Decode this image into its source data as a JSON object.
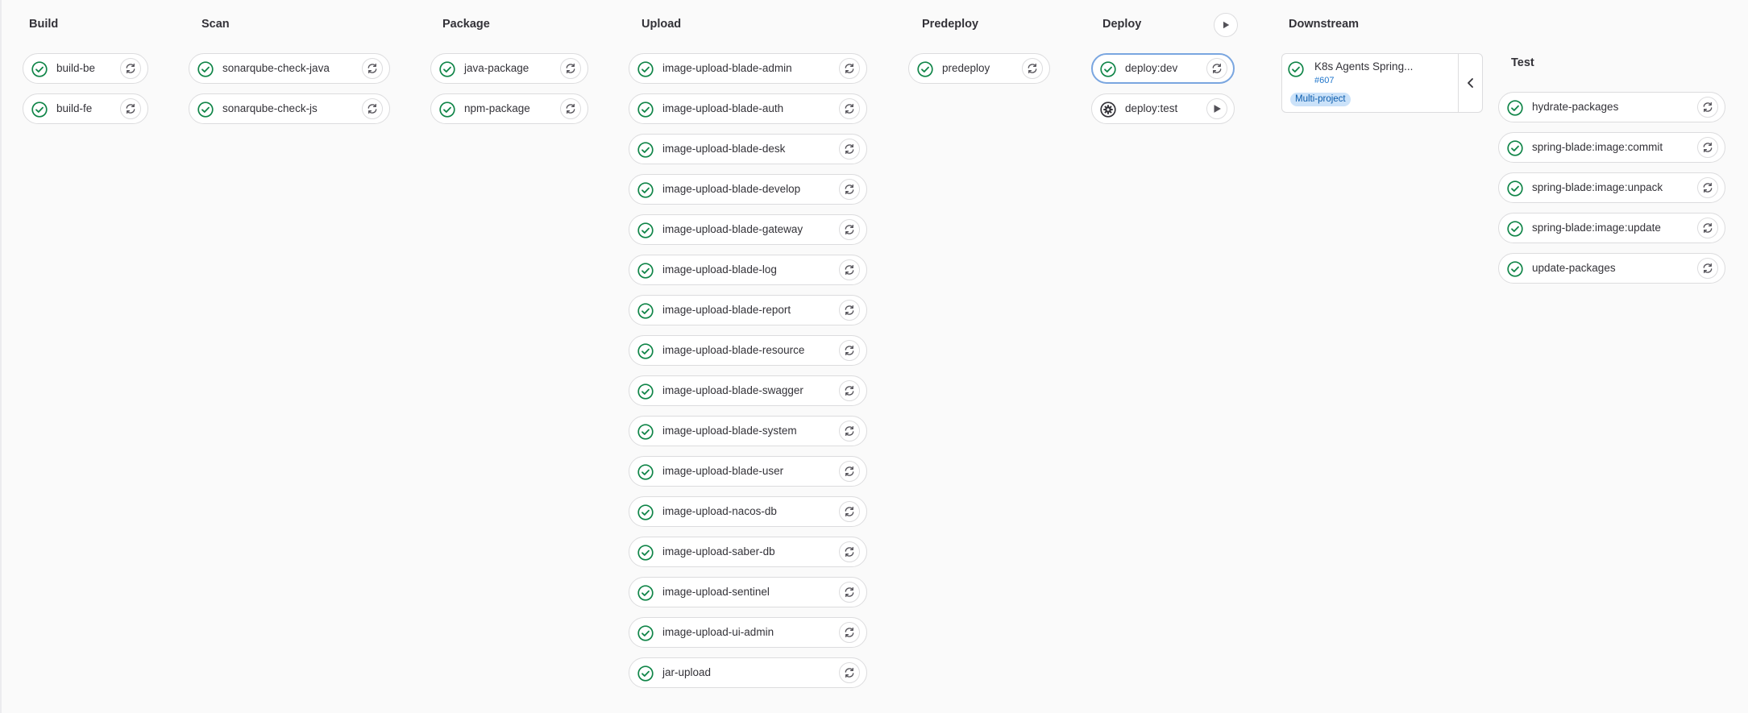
{
  "stages": [
    {
      "title": "Build",
      "jobs": [
        {
          "name": "build-be",
          "status": "success",
          "action": "retry"
        },
        {
          "name": "build-fe",
          "status": "success",
          "action": "retry"
        }
      ]
    },
    {
      "title": "Scan",
      "jobs": [
        {
          "name": "sonarqube-check-java",
          "status": "success",
          "action": "retry"
        },
        {
          "name": "sonarqube-check-js",
          "status": "success",
          "action": "retry"
        }
      ]
    },
    {
      "title": "Package",
      "jobs": [
        {
          "name": "java-package",
          "status": "success",
          "action": "retry"
        },
        {
          "name": "npm-package",
          "status": "success",
          "action": "retry"
        }
      ]
    },
    {
      "title": "Upload",
      "jobs": [
        {
          "name": "image-upload-blade-admin",
          "status": "success",
          "action": "retry"
        },
        {
          "name": "image-upload-blade-auth",
          "status": "success",
          "action": "retry"
        },
        {
          "name": "image-upload-blade-desk",
          "status": "success",
          "action": "retry"
        },
        {
          "name": "image-upload-blade-develop",
          "status": "success",
          "action": "retry"
        },
        {
          "name": "image-upload-blade-gateway",
          "status": "success",
          "action": "retry"
        },
        {
          "name": "image-upload-blade-log",
          "status": "success",
          "action": "retry"
        },
        {
          "name": "image-upload-blade-report",
          "status": "success",
          "action": "retry"
        },
        {
          "name": "image-upload-blade-resource",
          "status": "success",
          "action": "retry"
        },
        {
          "name": "image-upload-blade-swagger",
          "status": "success",
          "action": "retry"
        },
        {
          "name": "image-upload-blade-system",
          "status": "success",
          "action": "retry"
        },
        {
          "name": "image-upload-blade-user",
          "status": "success",
          "action": "retry"
        },
        {
          "name": "image-upload-nacos-db",
          "status": "success",
          "action": "retry"
        },
        {
          "name": "image-upload-saber-db",
          "status": "success",
          "action": "retry"
        },
        {
          "name": "image-upload-sentinel",
          "status": "success",
          "action": "retry"
        },
        {
          "name": "image-upload-ui-admin",
          "status": "success",
          "action": "retry"
        },
        {
          "name": "jar-upload",
          "status": "success",
          "action": "retry"
        }
      ]
    },
    {
      "title": "Predeploy",
      "jobs": [
        {
          "name": "predeploy",
          "status": "success",
          "action": "retry"
        }
      ]
    },
    {
      "title": "Deploy",
      "jobs": [
        {
          "name": "deploy:dev",
          "status": "success",
          "action": "retry",
          "selected": true
        },
        {
          "name": "deploy:test",
          "status": "manual",
          "action": "play"
        }
      ]
    },
    {
      "title": "Downstream",
      "jobs": []
    },
    {
      "title": "Test",
      "jobs": [
        {
          "name": "hydrate-packages",
          "status": "success",
          "action": "retry"
        },
        {
          "name": "spring-blade:image:commit",
          "status": "success",
          "action": "retry"
        },
        {
          "name": "spring-blade:image:unpack",
          "status": "success",
          "action": "retry"
        },
        {
          "name": "spring-blade:image:update",
          "status": "success",
          "action": "retry"
        },
        {
          "name": "update-packages",
          "status": "success",
          "action": "retry"
        }
      ]
    }
  ],
  "deploy_stage_action_icon": "play-icon",
  "downstream": {
    "title": "K8s Agents Spring...",
    "pipeline_id": "#607",
    "badge": "Multi-project",
    "status": "success",
    "collapse_icon": "chevron-left-icon"
  },
  "icons": {
    "success": "status-success-icon",
    "manual": "status-manual-icon",
    "retry": "retry-icon",
    "play": "play-icon"
  },
  "colors": {
    "success": "#108548",
    "manual": "#333238",
    "link": "#1f75cb",
    "badge_bg": "#cbe2f9",
    "selected_border": "#7aa6e0"
  }
}
